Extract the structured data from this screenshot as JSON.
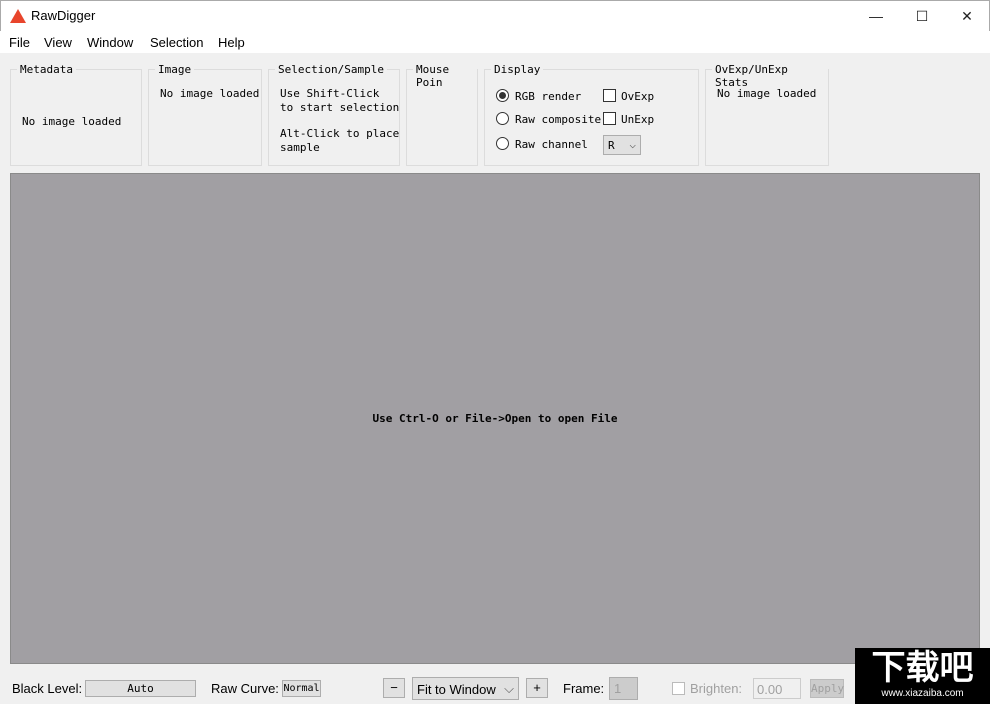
{
  "window": {
    "title": "RawDigger",
    "minimize": "—",
    "maximize": "☐",
    "close": "✕"
  },
  "menu": [
    "File",
    "View",
    "Window",
    "Selection",
    "Help"
  ],
  "panels": {
    "metadata": {
      "title": "Metadata",
      "text": "No image loaded"
    },
    "image": {
      "title": "Image",
      "text": "No image loaded"
    },
    "selection": {
      "title": "Selection/Sample",
      "line1": "Use Shift-Click\nto start selection",
      "line2": "Alt-Click to place\nsample"
    },
    "mouse": {
      "title": "Mouse Poin"
    },
    "display": {
      "title": "Display",
      "radios": [
        {
          "label": "RGB render",
          "checked": true
        },
        {
          "label": "Raw composite",
          "checked": false
        },
        {
          "label": "Raw channel",
          "checked": false
        }
      ],
      "checks": [
        {
          "label": "OvExp",
          "checked": false
        },
        {
          "label": "UnExp",
          "checked": false
        }
      ],
      "channel": "R"
    },
    "stats": {
      "title": "OvExp/UnExp Stats",
      "text": "No image loaded"
    }
  },
  "canvas": {
    "message": "Use Ctrl-O or File->Open to open File",
    "bg": "#a19fa3"
  },
  "bottom": {
    "black_level_label": "Black Level:",
    "black_level_value": "Auto",
    "raw_curve_label": "Raw Curve:",
    "raw_curve_value": "Normal",
    "zoom_out": "−",
    "zoom_value": "Fit to Window",
    "zoom_in": "+",
    "frame_label": "Frame:",
    "frame_value": "1",
    "brighten_label": "Brighten:",
    "brighten_value": "0.00",
    "apply": "Apply"
  },
  "watermark": {
    "text": "下载吧",
    "url": "www.xiazaiba.com"
  }
}
